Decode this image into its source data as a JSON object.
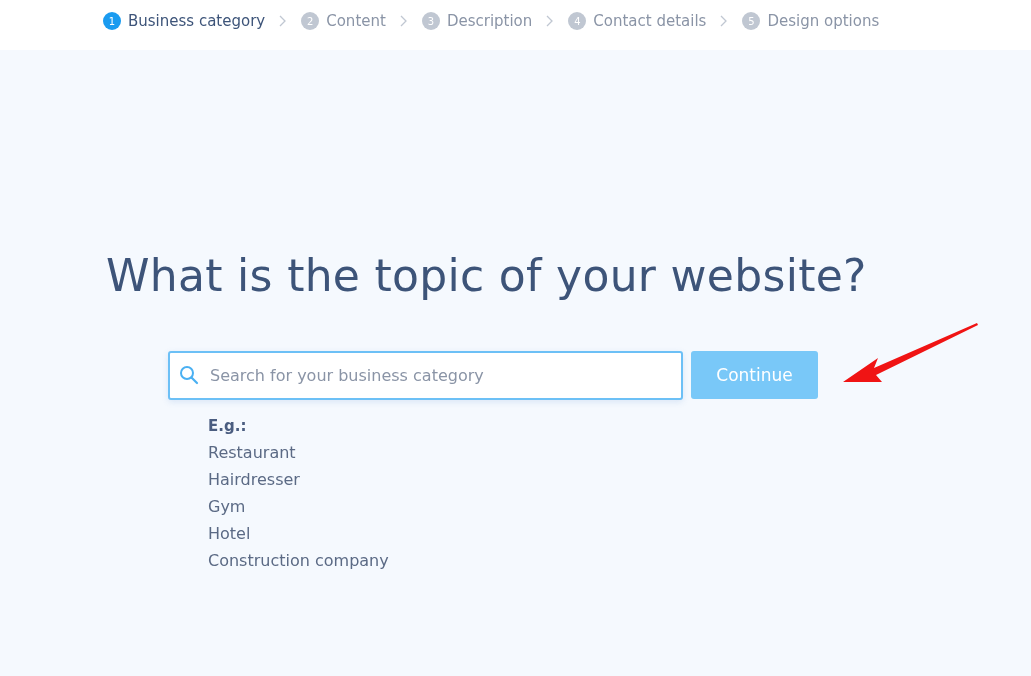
{
  "steps": [
    {
      "number": "1",
      "label": "Business category",
      "selected": true
    },
    {
      "number": "2",
      "label": "Content",
      "selected": false
    },
    {
      "number": "3",
      "label": "Description",
      "selected": false
    },
    {
      "number": "4",
      "label": "Contact details",
      "selected": false
    },
    {
      "number": "5",
      "label": "Design options",
      "selected": false
    }
  ],
  "heading": "What is the topic of your website?",
  "search": {
    "placeholder": "Search for your business category"
  },
  "continue_button": {
    "label": "Continue",
    "disabled": true
  },
  "examples": {
    "title": "E.g.:",
    "items": [
      "Restaurant",
      "Hairdresser",
      "Gym",
      "Hotel",
      "Construction company"
    ]
  }
}
